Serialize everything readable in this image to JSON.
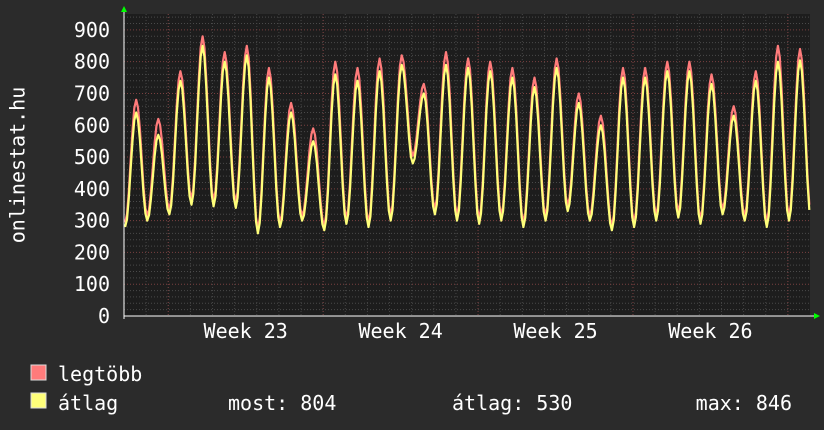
{
  "chart_data": {
    "type": "line",
    "ylabel": "onlinestat.hu",
    "ylim": [
      0,
      950
    ],
    "yticks": [
      0,
      100,
      200,
      300,
      400,
      500,
      600,
      700,
      800,
      900
    ],
    "x_tick_labels": [
      "Week 23",
      "Week 24",
      "Week 25",
      "Week 26"
    ],
    "grid": true,
    "period_days": 31,
    "series": [
      {
        "name": "legtöbb",
        "color": "#ff7b7b",
        "values": [
          680,
          620,
          770,
          880,
          830,
          850,
          780,
          670,
          590,
          800,
          780,
          810,
          820,
          730,
          830,
          810,
          800,
          780,
          750,
          810,
          700,
          630,
          780,
          780,
          800,
          800,
          760,
          660,
          770,
          850,
          840
        ]
      },
      {
        "name": "átlag",
        "color": "#ffff7a",
        "values": [
          640,
          570,
          740,
          850,
          800,
          820,
          750,
          640,
          550,
          760,
          740,
          770,
          790,
          700,
          790,
          780,
          770,
          750,
          720,
          780,
          670,
          600,
          750,
          750,
          770,
          770,
          730,
          630,
          740,
          800,
          804
        ]
      }
    ],
    "minima": [
      280,
      300,
      320,
      350,
      345,
      340,
      260,
      280,
      300,
      270,
      290,
      280,
      300,
      480,
      320,
      300,
      290,
      300,
      280,
      300,
      330,
      300,
      270,
      280,
      300,
      310,
      290,
      320,
      300,
      280,
      300
    ]
  },
  "legend": {
    "items": [
      {
        "label": "legtöbb",
        "color": "#ff7b7b"
      },
      {
        "label": "átlag",
        "color": "#ffff7a"
      }
    ],
    "stats": {
      "most": "most: 804",
      "atlag": "átlag: 530",
      "max": "max: 846"
    }
  }
}
